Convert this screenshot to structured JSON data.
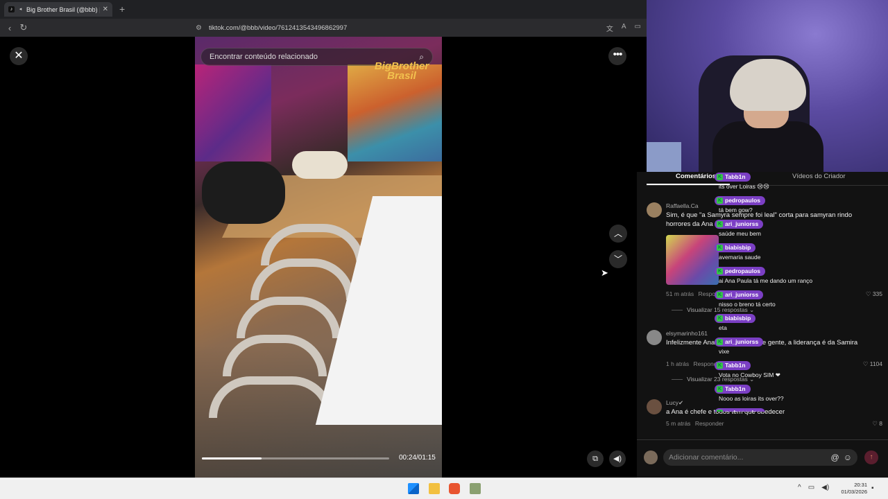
{
  "browser": {
    "tab_title": "Big Brother Brasil (@bbb) | Ti",
    "new_tab": "+",
    "url": "tiktok.com/@bbb/video/7612413543496862997"
  },
  "video": {
    "search_placeholder": "Encontrar conteúdo relacionado",
    "logo_text": "BigBrother Brasil",
    "time": "00:24/01:15",
    "progress": 0.32
  },
  "tabs": {
    "comments": "Comentários",
    "creator_videos": "Vídeos do Criador"
  },
  "comments": [
    {
      "user": "Raffaella.Ca",
      "text": "Sim, é que \"a Samyra sempre foi leal\" corta para samyran rindo horrores da Ana Paula",
      "time": "51 m atrás",
      "reply": "Responder",
      "likes": "335",
      "view_replies": "Visualizar 15 respostas"
    },
    {
      "user": "elsymarinho161",
      "text": "Infelizmente Ana Paula é chefe de gente, a liderança é da Samira",
      "time": "1 h atrás",
      "reply": "Responder",
      "likes": "1104",
      "view_replies": "Visualizar 23 respostas"
    },
    {
      "user": "Lucy✔",
      "text": "a Ana é chefe e todos tem que obedecer",
      "time": "5 m atrás",
      "reply": "Responder",
      "likes": "8"
    }
  ],
  "input": {
    "placeholder": "Adicionar comentário...",
    "mention": "@",
    "emoji": "☺"
  },
  "chat": [
    {
      "user": "Tabb1n",
      "text": "its over Loiras 😢😢"
    },
    {
      "user": "pedropaulos",
      "text": "tá bem gow?"
    },
    {
      "user": "ari_juniorss",
      "text": "saúde meu bem"
    },
    {
      "user": "biabisbip",
      "text": "avemaria saude"
    },
    {
      "user": "pedropaulos",
      "text": "ai Ana Paula tá me dando um ranço"
    },
    {
      "user": "ari_juniorss",
      "text": "nisso o breno tá certo"
    },
    {
      "user": "biabisbip",
      "text": "eta"
    },
    {
      "user": "ari_juniorss",
      "text": "vixe"
    },
    {
      "user": "Tabb1n",
      "text": "Vota no Cowboy SIM ❤"
    },
    {
      "user": "Tabb1n",
      "text": "Nooo as loiras its over??"
    },
    {
      "user": "pedropaulos",
      "text": ""
    }
  ],
  "taskbar": {
    "time": "20:31",
    "date": "01/03/2026"
  },
  "colors": {
    "chat_badge": "#7b3fc4",
    "badge_icon": "#37c24d",
    "panel_bg": "#121212"
  }
}
